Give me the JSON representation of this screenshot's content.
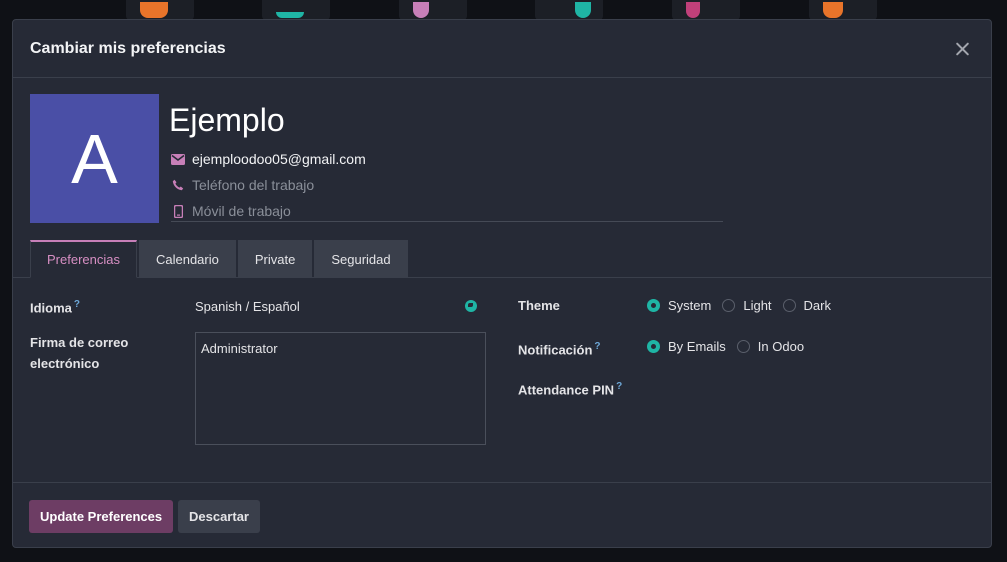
{
  "dialog": {
    "title": "Cambiar mis preferencias"
  },
  "profile": {
    "avatar_letter": "A",
    "name": "Ejemplo",
    "email": "ejemploodoo05@gmail.com",
    "work_phone_placeholder": "Teléfono del trabajo",
    "work_mobile_placeholder": "Móvil de trabajo"
  },
  "tabs": [
    {
      "label": "Preferencias",
      "active": true
    },
    {
      "label": "Calendario",
      "active": false
    },
    {
      "label": "Private",
      "active": false
    },
    {
      "label": "Seguridad",
      "active": false
    }
  ],
  "preferences": {
    "language_label": "Idioma",
    "language_help": "?",
    "language_value": "Spanish / Español",
    "signature_label": "Firma de correo electrónico",
    "signature_value": "Administrator",
    "theme_label": "Theme",
    "theme_options": [
      {
        "label": "System",
        "selected": true
      },
      {
        "label": "Light",
        "selected": false
      },
      {
        "label": "Dark",
        "selected": false
      }
    ],
    "notification_label": "Notificación",
    "notification_help": "?",
    "notification_options": [
      {
        "label": "By Emails",
        "selected": true
      },
      {
        "label": "In Odoo",
        "selected": false
      }
    ],
    "attendance_pin_label": "Attendance PIN",
    "attendance_pin_help": "?"
  },
  "footer": {
    "update_label": "Update Preferences",
    "discard_label": "Descartar"
  },
  "colors": {
    "accent": "#c77fb8",
    "radio_selected": "#1fb5a5",
    "avatar_bg": "#4a4fa6",
    "primary_button": "#6d3d64"
  },
  "icons": {
    "close": "close-icon",
    "email": "envelope-icon",
    "phone": "phone-icon",
    "mobile": "mobile-icon",
    "language": "globe-icon"
  }
}
